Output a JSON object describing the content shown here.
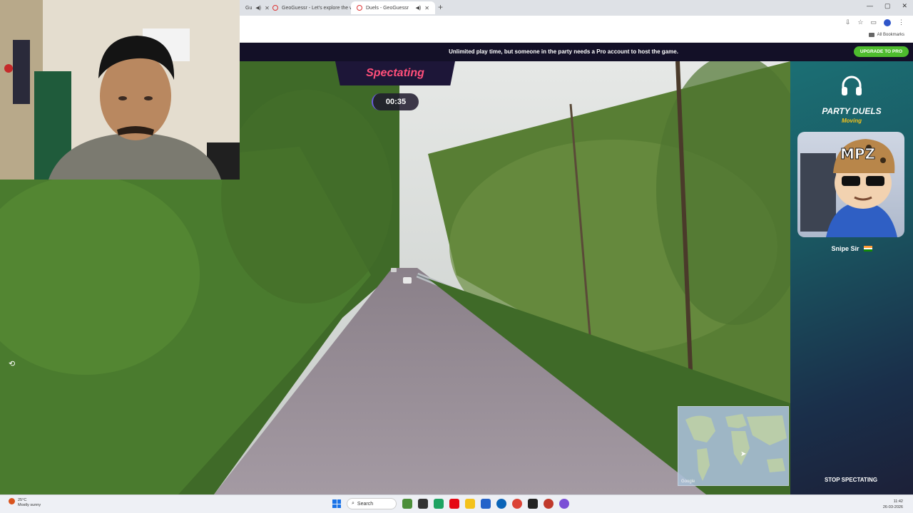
{
  "browser": {
    "tabs": [
      {
        "title": "Gu",
        "active": false
      },
      {
        "title": "GeoGuessr - Let's explore the w",
        "active": false
      },
      {
        "title": "Duels - GeoGuessr",
        "active": true
      }
    ],
    "new_tab": "+",
    "window_controls": [
      "—",
      "▢",
      "✕"
    ],
    "all_bookmarks": "All Bookmarks"
  },
  "banner": {
    "text": "Unlimited play time, but someone in the party needs a Pro account to host the game.",
    "upgrade_button": "UPGRADE TO PRO",
    "accent": "#4ebc2e"
  },
  "game": {
    "status": "Spectating",
    "timer": "00:35",
    "map_watermark": "Google"
  },
  "panel": {
    "title": "PARTY DUELS",
    "subtitle": "Moving",
    "avatar_text": "MPZ",
    "player_name": "Snipe Sir",
    "player_flag": "india-flag-icon",
    "stop_button": "STOP SPECTATING"
  },
  "taskbar": {
    "weather_temp": "25°C",
    "weather_desc": "Mostly sunny",
    "search_label": "Search",
    "time": "11:42",
    "date": "26-03-2026"
  }
}
